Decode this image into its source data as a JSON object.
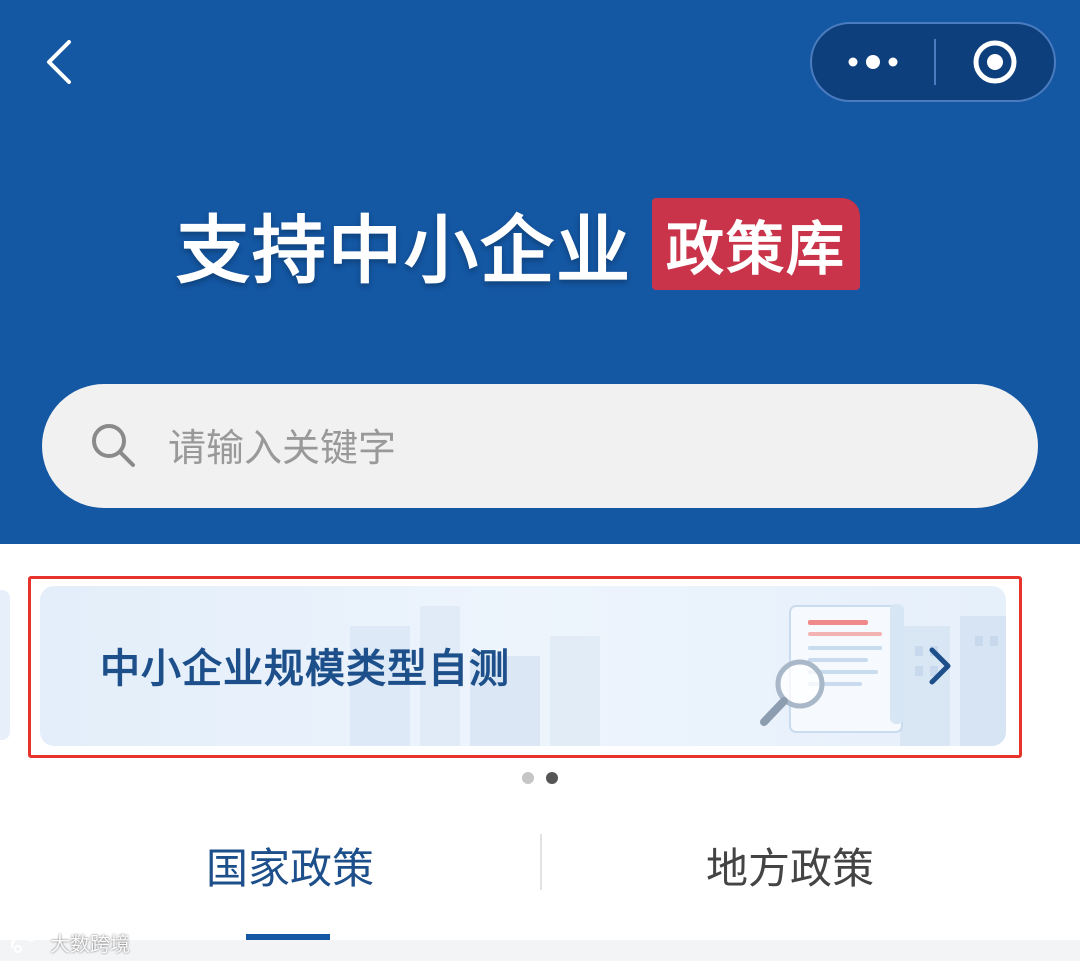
{
  "header": {
    "title": "支持中小企业",
    "title_badge": "政策库",
    "colors": {
      "background": "#1457a3",
      "badge": "#c9344a"
    }
  },
  "nav": {
    "back_icon": "chevron-left-icon",
    "more_icon": "more-dots-icon",
    "close_icon": "target-close-icon"
  },
  "search": {
    "placeholder": "请输入关键字",
    "value": ""
  },
  "banner": {
    "label": "中小企业规模类型自测",
    "arrow_icon": "chevron-right-icon",
    "illustration_icon": "document-magnifier-icon"
  },
  "carousel": {
    "total": 2,
    "active_index": 1
  },
  "tabs": [
    {
      "label": "国家政策",
      "active": true
    },
    {
      "label": "地方政策",
      "active": false
    }
  ],
  "watermark": "大数跨境"
}
